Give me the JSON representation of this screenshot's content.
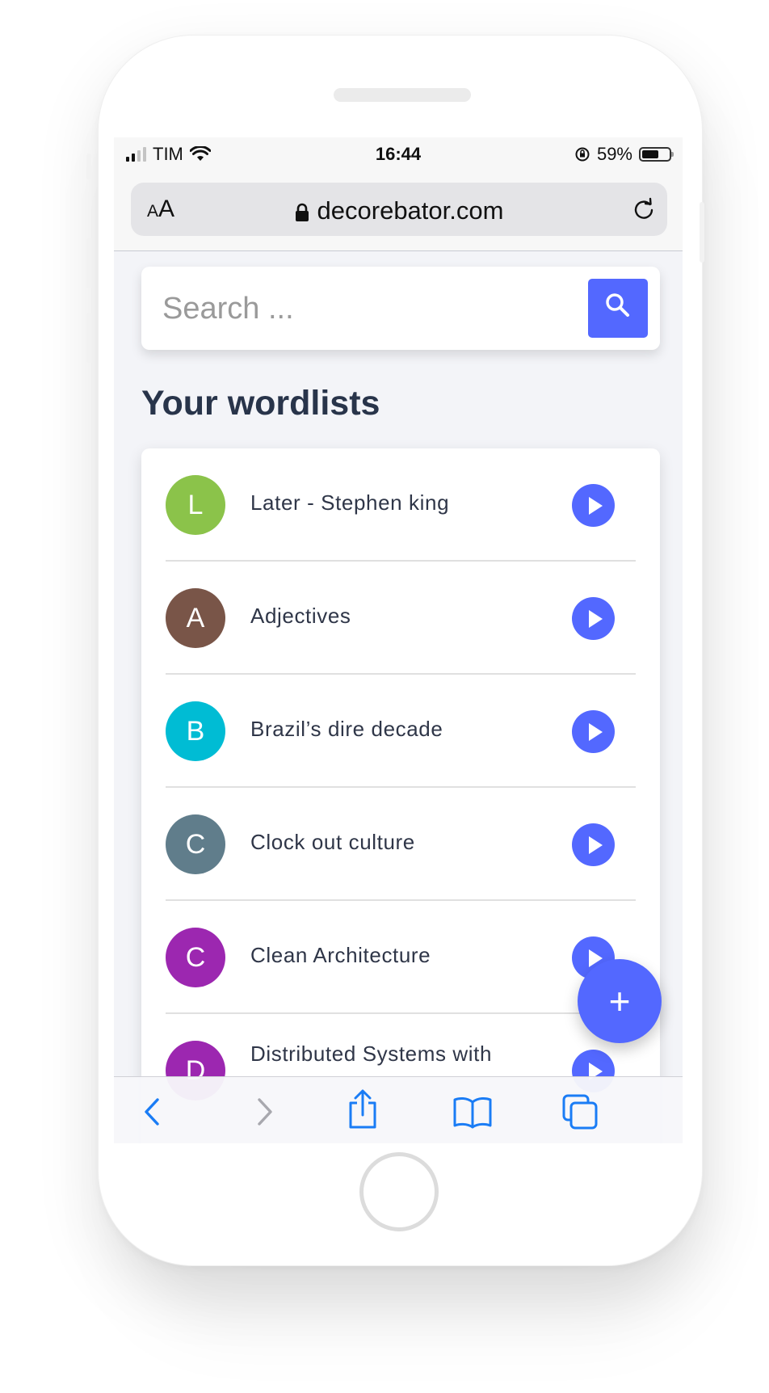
{
  "status_bar": {
    "carrier": "TIM",
    "time": "16:44",
    "battery_percent": "59%",
    "battery_level": 0.59
  },
  "address_bar": {
    "text_size_small": "A",
    "text_size_large": "A",
    "domain": "decorebator.com"
  },
  "search": {
    "placeholder": "Search ..."
  },
  "section_title": "Your wordlists",
  "wordlists": [
    {
      "initial": "L",
      "label": "Later - Stephen king",
      "color": "#8bc34a"
    },
    {
      "initial": "A",
      "label": "Adjectives",
      "color": "#795548"
    },
    {
      "initial": "B",
      "label": "Brazil’s dire decade",
      "color": "#00bcd4"
    },
    {
      "initial": "C",
      "label": "Clock out culture",
      "color": "#607d8b"
    },
    {
      "initial": "C",
      "label": "Clean Architecture",
      "color": "#9c27b0"
    },
    {
      "initial": "D",
      "label": "Distributed Systems with",
      "color": "#9c27b0"
    }
  ],
  "fab": {
    "label": "+"
  },
  "colors": {
    "accent": "#5368ff",
    "title_text": "#28344a",
    "ios_blue": "#1a7cf5"
  },
  "toolbar": {
    "icons": [
      "chevron-left-icon",
      "chevron-right-icon",
      "share-icon",
      "bookmarks-icon",
      "tabs-icon"
    ]
  }
}
